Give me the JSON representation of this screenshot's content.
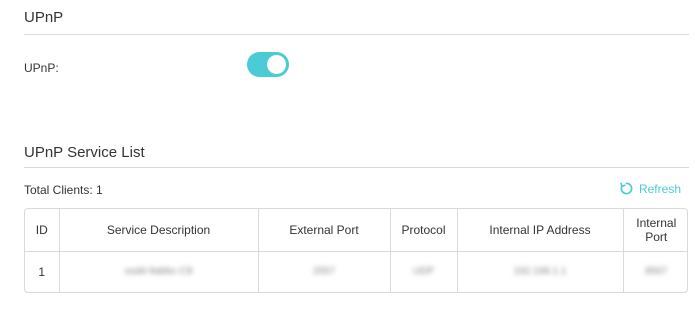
{
  "upnp_section": {
    "title": "UPnP",
    "label": "UPnP:",
    "enabled": true
  },
  "service_list": {
    "title": "UPnP Service List",
    "total_clients": "Total Clients: 1",
    "refresh_label": "Refresh",
    "columns": [
      "ID",
      "Service Description",
      "External Port",
      "Protocol",
      "Internal IP Address",
      "Internal Port"
    ],
    "rows": [
      {
        "id": "1",
        "service_description": "ssdd-9abbc-C8",
        "external_port": "2557",
        "protocol": "UDP",
        "internal_ip": "192.168.1.1",
        "internal_port": "8567"
      }
    ]
  },
  "colors": {
    "accent": "#4acbd6",
    "divider": "#d9d9d9",
    "text": "#333333"
  }
}
